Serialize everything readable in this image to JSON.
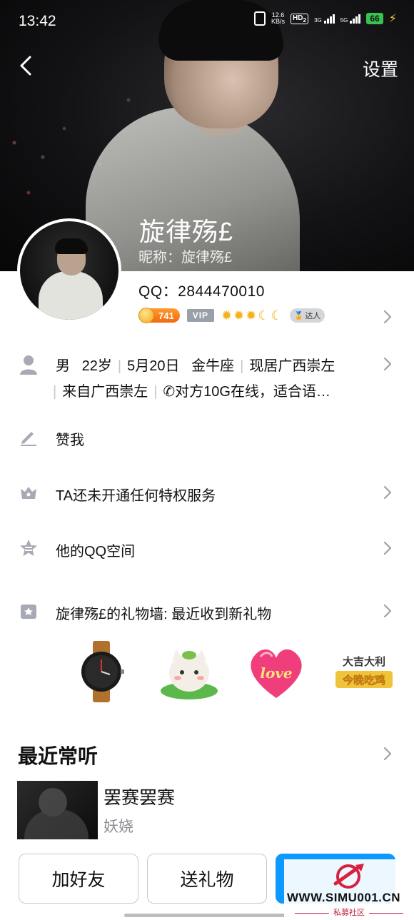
{
  "status_bar": {
    "time": "13:42",
    "speed_value": "12.6",
    "speed_unit": "KB/s",
    "hd_label": "HD",
    "hd_sub": "2",
    "net1_label": "3G",
    "net2_label": "5G",
    "battery": "66"
  },
  "header": {
    "settings_label": "设置",
    "name": "旋律殇£",
    "nickname": "昵称：旋律殇£"
  },
  "profile": {
    "qq_number": "QQ：2844470010",
    "coin_value": "741",
    "vip_label": "VIP",
    "daren_label": "达人"
  },
  "info": {
    "gender": "男",
    "age": "22岁",
    "birthday": "5月20日",
    "zodiac": "金牛座",
    "residence": "现居广西崇左",
    "hometown": "来自广西崇左",
    "status": "✆对方10G在线，适合语…"
  },
  "rows": {
    "like": "赞我",
    "privilege": "TA还未开通任何特权服务",
    "qzone": "他的QQ空间",
    "gift_wall": "旋律殇£的礼物墙: 最近收到新礼物"
  },
  "gifts": {
    "love_text": "love",
    "chicken_text_top": "大吉大利",
    "chicken_text_bottom": "今晚吃鸡"
  },
  "recent": {
    "title": "最近常听",
    "song_title": "罢赛罢赛",
    "song_artist": "妖娆"
  },
  "actions": {
    "add_friend": "加好友",
    "send_gift": "送礼物",
    "send_message": ""
  },
  "watermark": {
    "site": "WWW.SIMU001.CN",
    "sub": "私募社区"
  },
  "colors": {
    "primary_blue": "#0d99ff",
    "coin_orange": "#f06a12",
    "level_gold": "#f4b21b",
    "watermark_red": "#c0183c"
  }
}
